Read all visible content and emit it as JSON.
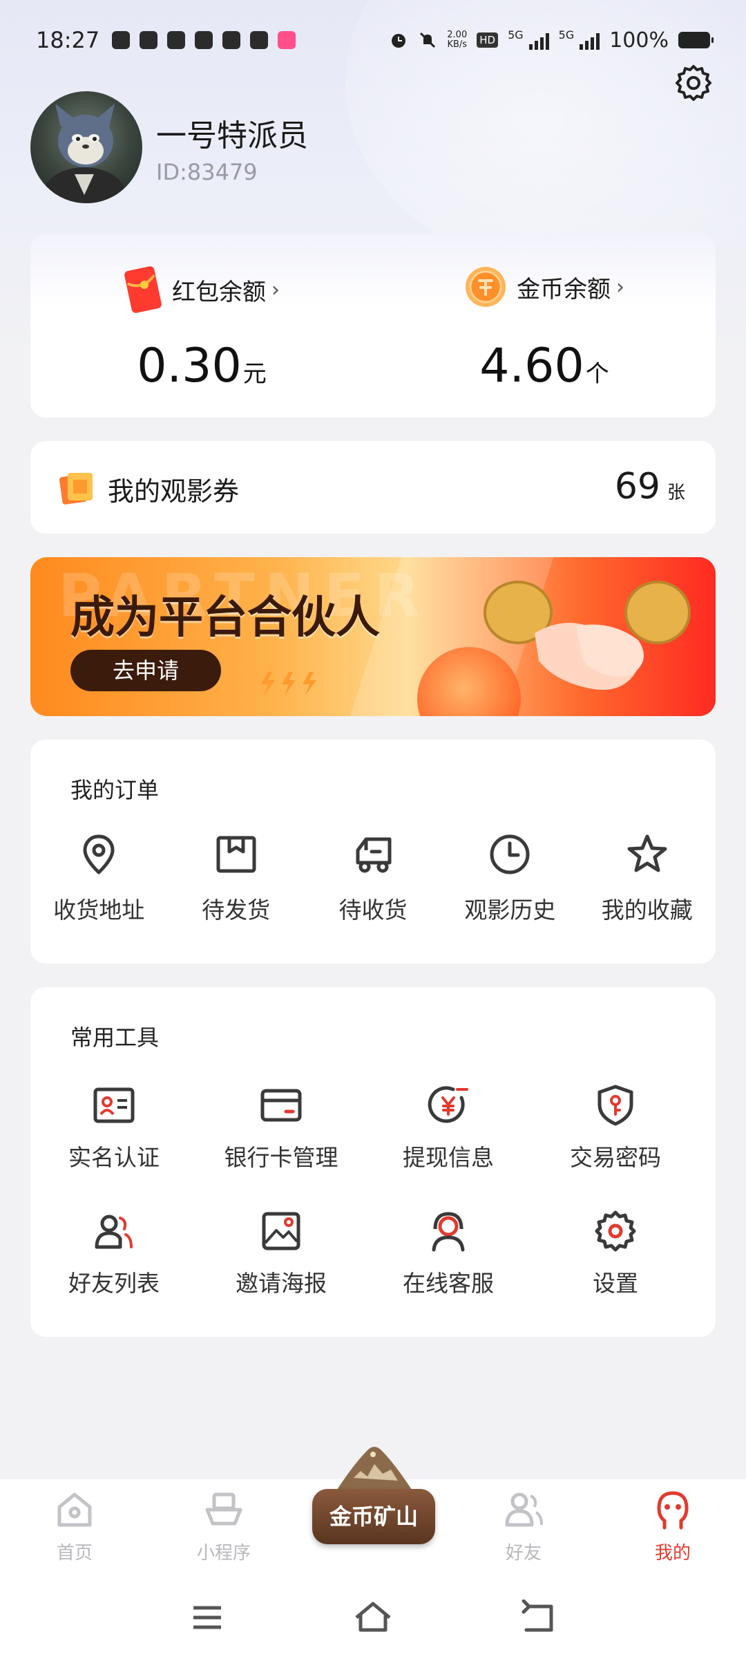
{
  "status_bar": {
    "time": "18:27",
    "net_speed_value": "2.00",
    "net_speed_unit": "KB/s",
    "hd_label": "HD",
    "sim1_label": "5G",
    "sim2_label": "5G",
    "battery": "100%"
  },
  "profile": {
    "name": "一号特派员",
    "id_text": "ID:83479"
  },
  "balance": {
    "red_packet_label": "红包余额",
    "red_packet_value": "0.30",
    "red_packet_unit": "元",
    "coin_label": "金币余额",
    "coin_value": "4.60",
    "coin_unit": "个",
    "chevron": "›"
  },
  "ticket": {
    "label": "我的观影券",
    "count": "69",
    "unit": "张"
  },
  "banner": {
    "title": "成为平台合伙人",
    "button": "去申请"
  },
  "orders": {
    "title": "我的订单",
    "items": [
      {
        "label": "收货地址",
        "icon": "location-pin-icon"
      },
      {
        "label": "待发货",
        "icon": "box-icon"
      },
      {
        "label": "待收货",
        "icon": "truck-icon"
      },
      {
        "label": "观影历史",
        "icon": "clock-icon"
      },
      {
        "label": "我的收藏",
        "icon": "star-icon"
      }
    ]
  },
  "tools": {
    "title": "常用工具",
    "items": [
      {
        "label": "实名认证",
        "icon": "id-card-icon"
      },
      {
        "label": "银行卡管理",
        "icon": "bank-card-icon"
      },
      {
        "label": "提现信息",
        "icon": "yuan-withdraw-icon"
      },
      {
        "label": "交易密码",
        "icon": "shield-key-icon"
      },
      {
        "label": "好友列表",
        "icon": "friends-icon"
      },
      {
        "label": "邀请海报",
        "icon": "image-icon"
      },
      {
        "label": "在线客服",
        "icon": "headset-icon"
      },
      {
        "label": "设置",
        "icon": "gear-icon"
      }
    ]
  },
  "bottom_nav": {
    "home": "首页",
    "mini_program": "小程序",
    "center": "金币矿山",
    "friends": "好友",
    "mine": "我的",
    "active_color": "#e23a2e",
    "inactive_color": "#b8b8bd"
  },
  "colors": {
    "accent_red": "#e23a2e",
    "icon_dark": "#3a3a3a"
  }
}
